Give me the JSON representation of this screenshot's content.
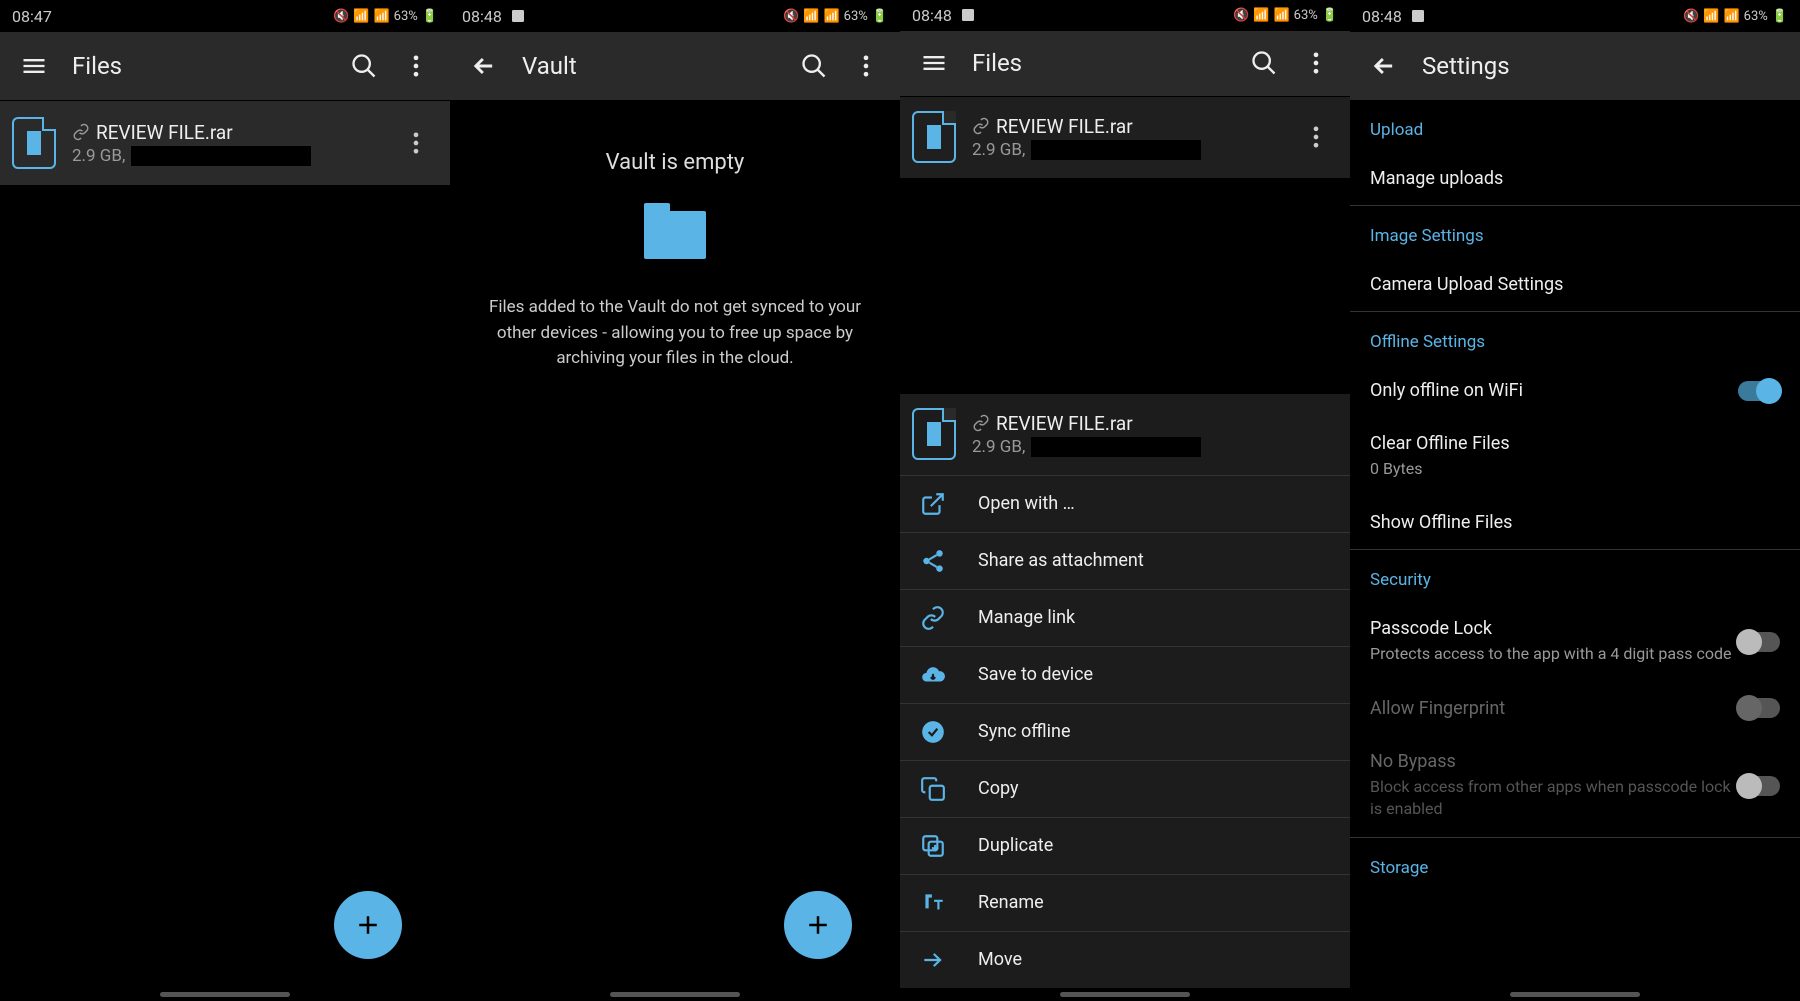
{
  "screen1": {
    "status": {
      "time": "08:47",
      "battery": "63%"
    },
    "appbar": {
      "title": "Files"
    },
    "file": {
      "name": "REVIEW FILE.rar",
      "size": "2.9 GB,"
    }
  },
  "screen2": {
    "status": {
      "time": "08:48",
      "battery": "63%"
    },
    "appbar": {
      "title": "Vault"
    },
    "empty": {
      "title": "Vault is empty",
      "desc": "Files added to the Vault do not get synced to your other devices - allowing you to free up space by archiving your files in the cloud."
    }
  },
  "screen3": {
    "status": {
      "time": "08:48",
      "battery": "63%"
    },
    "appbar": {
      "title": "Files"
    },
    "file": {
      "name": "REVIEW FILE.rar",
      "size": "2.9 GB,"
    },
    "sheet": {
      "fileName": "REVIEW FILE.rar",
      "fileSize": "2.9 GB,",
      "items": [
        {
          "key": "open-with",
          "label": "Open with …",
          "icon": "open-external-icon"
        },
        {
          "key": "share",
          "label": "Share as attachment",
          "icon": "share-icon"
        },
        {
          "key": "manage-link",
          "label": "Manage link",
          "icon": "link-icon"
        },
        {
          "key": "save",
          "label": "Save to device",
          "icon": "cloud-download-icon"
        },
        {
          "key": "sync-offline",
          "label": "Sync offline",
          "icon": "check-circle-icon"
        },
        {
          "key": "copy",
          "label": "Copy",
          "icon": "copy-icon"
        },
        {
          "key": "duplicate",
          "label": "Duplicate",
          "icon": "duplicate-icon"
        },
        {
          "key": "rename",
          "label": "Rename",
          "icon": "text-format-icon"
        },
        {
          "key": "move",
          "label": "Move",
          "icon": "arrow-right-icon"
        }
      ]
    }
  },
  "screen4": {
    "status": {
      "time": "08:48",
      "battery": "63%"
    },
    "appbar": {
      "title": "Settings"
    },
    "sections": {
      "upload": {
        "header": "Upload",
        "manage": "Manage uploads"
      },
      "image": {
        "header": "Image Settings",
        "camera": "Camera Upload Settings"
      },
      "offline": {
        "header": "Offline Settings",
        "wifi": "Only offline on WiFi",
        "clear": "Clear Offline Files",
        "clearSub": "0 Bytes",
        "show": "Show Offline Files"
      },
      "security": {
        "header": "Security",
        "passcode": "Passcode Lock",
        "passcodeSub": "Protects access to the app with a 4 digit pass code",
        "fingerprint": "Allow Fingerprint",
        "nobypass": "No Bypass",
        "nobypassSub": "Block access from other apps when passcode lock is enabled"
      },
      "storage": {
        "header": "Storage"
      }
    }
  }
}
